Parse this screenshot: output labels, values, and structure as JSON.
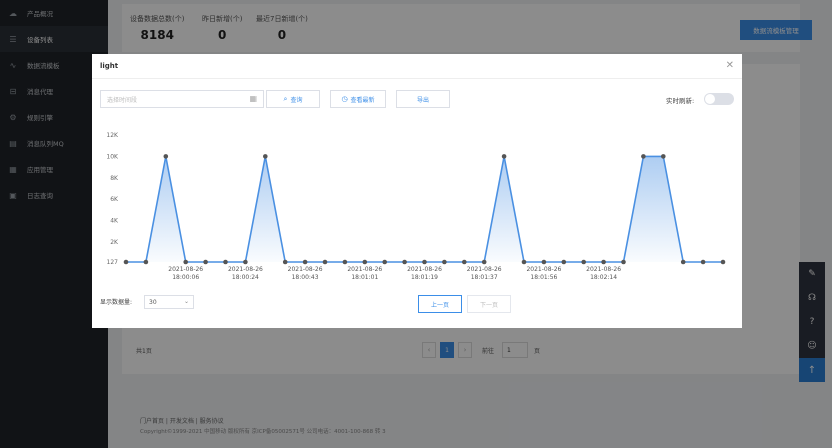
{
  "sidebar": {
    "items": [
      {
        "label": "产品概况",
        "icon": "cloud-icon",
        "glyph": "☁"
      },
      {
        "label": "设备列表",
        "icon": "list-icon",
        "glyph": "☰",
        "active": true
      },
      {
        "label": "数据流模板",
        "icon": "trend-icon",
        "glyph": "∿"
      },
      {
        "label": "消息代理",
        "icon": "proxy-icon",
        "glyph": "⊟"
      },
      {
        "label": "规则引擎",
        "icon": "gear-icon",
        "glyph": "⚙"
      },
      {
        "label": "消息队列MQ",
        "icon": "queue-icon",
        "glyph": "▤"
      },
      {
        "label": "应用管理",
        "icon": "apps-icon",
        "glyph": "▦"
      },
      {
        "label": "日志查询",
        "icon": "log-icon",
        "glyph": "▣"
      }
    ]
  },
  "header": {
    "stats": [
      {
        "label": "设备数据总数(个)",
        "value": "8184"
      },
      {
        "label": "昨日新增(个)",
        "value": "0"
      },
      {
        "label": "最近7日新增(个)",
        "value": "0"
      }
    ],
    "manage_button": "数据流模板管理"
  },
  "background_pager": {
    "total": "共1页",
    "page": "1",
    "goto_label": "前往",
    "goto_value": "1",
    "page_suffix": "页"
  },
  "footer": {
    "links": "门户首页 | 开发文档 | 服务协议",
    "copyright": "Copyright©1999-2021 中国移动 版权所有 京ICP备05002571号 公司电话：4001-100-868 转 3"
  },
  "modal": {
    "title": "light",
    "date_placeholder": "选择时间段",
    "query_button": "查询",
    "recent_button": "查看最新",
    "export_button": "导出",
    "realtime_label": "实时刷新:",
    "page_size_label": "显示数据量:",
    "page_size_value": "30",
    "prev_button": "上一页",
    "next_button": "下一页"
  },
  "chart_data": {
    "type": "area",
    "title": "",
    "xlabel": "",
    "ylabel": "",
    "y_ticks": [
      "12K",
      "10K",
      "8K",
      "6K",
      "4K",
      "2K",
      "127"
    ],
    "ylim": [
      127,
      12000
    ],
    "values": [
      127,
      127,
      10000,
      127,
      127,
      127,
      127,
      10000,
      127,
      127,
      127,
      127,
      127,
      127,
      127,
      127,
      127,
      127,
      127,
      10000,
      127,
      127,
      127,
      127,
      127,
      127,
      10000,
      10000,
      127,
      127,
      127
    ],
    "x_tick_labels": [
      {
        "date": "2021-08-26",
        "time": "18:00:06",
        "index": 3
      },
      {
        "date": "2021-08-26",
        "time": "18:00:24",
        "index": 6
      },
      {
        "date": "2021-08-26",
        "time": "18:00:43",
        "index": 9
      },
      {
        "date": "2021-08-26",
        "time": "18:01:01",
        "index": 12
      },
      {
        "date": "2021-08-26",
        "time": "18:01:19",
        "index": 15
      },
      {
        "date": "2021-08-26",
        "time": "18:01:37",
        "index": 18
      },
      {
        "date": "2021-08-26",
        "time": "18:01:56",
        "index": 21
      },
      {
        "date": "2021-08-26",
        "time": "18:02:14",
        "index": 24
      }
    ],
    "colors": {
      "line": "#4a90e2",
      "point": "#555555",
      "fill": "#4a90e2"
    },
    "grid": false
  },
  "toolbar": {
    "items": [
      {
        "icon": "edit-icon",
        "glyph": "✎"
      },
      {
        "icon": "headset-icon",
        "glyph": "☊"
      },
      {
        "icon": "help-icon",
        "glyph": "?"
      },
      {
        "icon": "user-icon",
        "glyph": "☺"
      }
    ],
    "top_icon": {
      "icon": "arrow-up-icon",
      "glyph": "↑"
    }
  }
}
